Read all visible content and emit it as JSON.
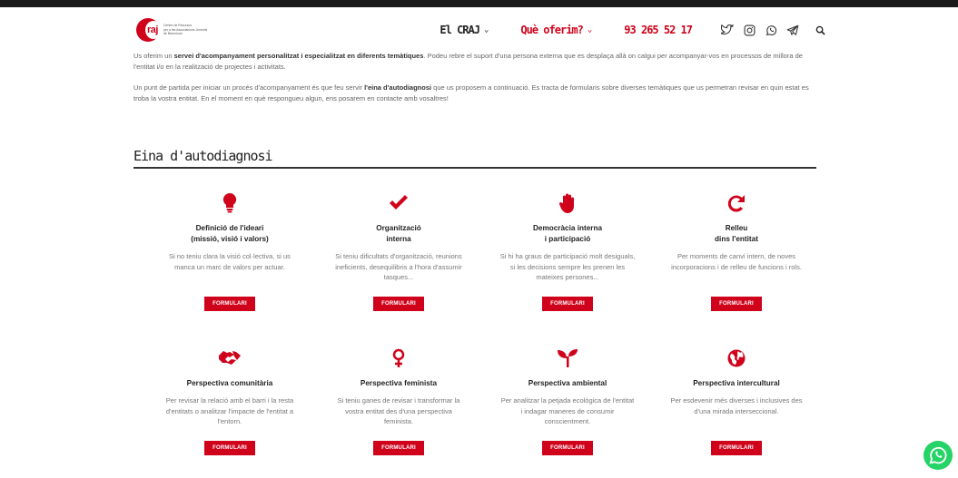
{
  "header": {
    "logo_text": "raj",
    "logo_sub": [
      "Centre de Recursos",
      "per a les Associacions Juvenils",
      "de Barcelona"
    ],
    "nav": [
      {
        "label": "El CRAJ",
        "chevron": "⌄"
      },
      {
        "label": "Què oferim?",
        "chevron": "⌄"
      }
    ],
    "phone": "93 265 52 17",
    "social_icons": [
      "twitter-icon",
      "instagram-icon",
      "whatsapp-icon",
      "telegram-icon"
    ]
  },
  "intro": {
    "p1_pre": "Us oferim un ",
    "p1_bold": "servei d'acompanyament personalitzat i especialitzat en diferents temàtiques",
    "p1_post": ". Podeu rebre el suport d'una persona externa que es desplaça allà on calgui per acompanyar-vos en processos de millora de l'entitat i/o en la realització de projectes i activitats.",
    "p2_pre": "Un punt de partida per iniciar un procés d'acompanyament és que feu servir ",
    "p2_bold": "l'eina d'autodiagnosi",
    "p2_post": " que us proposem a continuació. Es tracta de formularis sobre diverses temàtiques que us permetran revisar en quin estat es troba la vostra entitat. En el moment en què respongueu algun, ens posarem en contacte amb vosaltres!"
  },
  "section_title": "Eina d'autodiagnosi",
  "button_label": "FORMULARI",
  "cards": [
    {
      "icon": "lightbulb-icon",
      "title1": "Definició de l'ideari",
      "title2": "(missió, visió i valors)",
      "desc": "Si no teniu clara la visió col·lectiva, si us manca un marc de valors per actuar."
    },
    {
      "icon": "check-icon",
      "title1": "Organització",
      "title2": "interna",
      "desc": "Si teniu dificultats d'organització, reunions ineficients, desequilibris a l'hora d'assumir tasques..."
    },
    {
      "icon": "hand-icon",
      "title1": "Democràcia interna",
      "title2": "i participació",
      "desc": "Si hi ha graus de participació molt desiguals, si les decisions sempre les prenen les mateixes persones..."
    },
    {
      "icon": "redo-icon",
      "title1": "Relleu",
      "title2": "dins l'entitat",
      "desc": "Per moments de canvi intern, de noves incorporacions i de relleu de funcions i rols."
    },
    {
      "icon": "handshake-icon",
      "title1": "Perspectiva comunitària",
      "title2": "",
      "desc": "Per revisar la relació amb el barri i la resta d'entitats o analitzar l'impacte de l'entitat a l'entorn."
    },
    {
      "icon": "venus-icon",
      "title1": "Perspectiva feminista",
      "title2": "",
      "desc": "Si teniu ganes de revisar i transformar la vostra entitat des d'una perspectiva feminista."
    },
    {
      "icon": "seedling-icon",
      "title1": "Perspectiva ambiental",
      "title2": "",
      "desc": "Per analitzar la petjada ecològica de l'entitat i indagar maneres de consumir conscientment."
    },
    {
      "icon": "globe-icon",
      "title1": "Perspectiva intercultural",
      "title2": "",
      "desc": "Per esdevenir més diverses i inclusives des d'una mirada interseccional."
    }
  ],
  "colors": {
    "accent": "#d0021b",
    "whatsapp": "#25d366",
    "text": "#444444"
  }
}
